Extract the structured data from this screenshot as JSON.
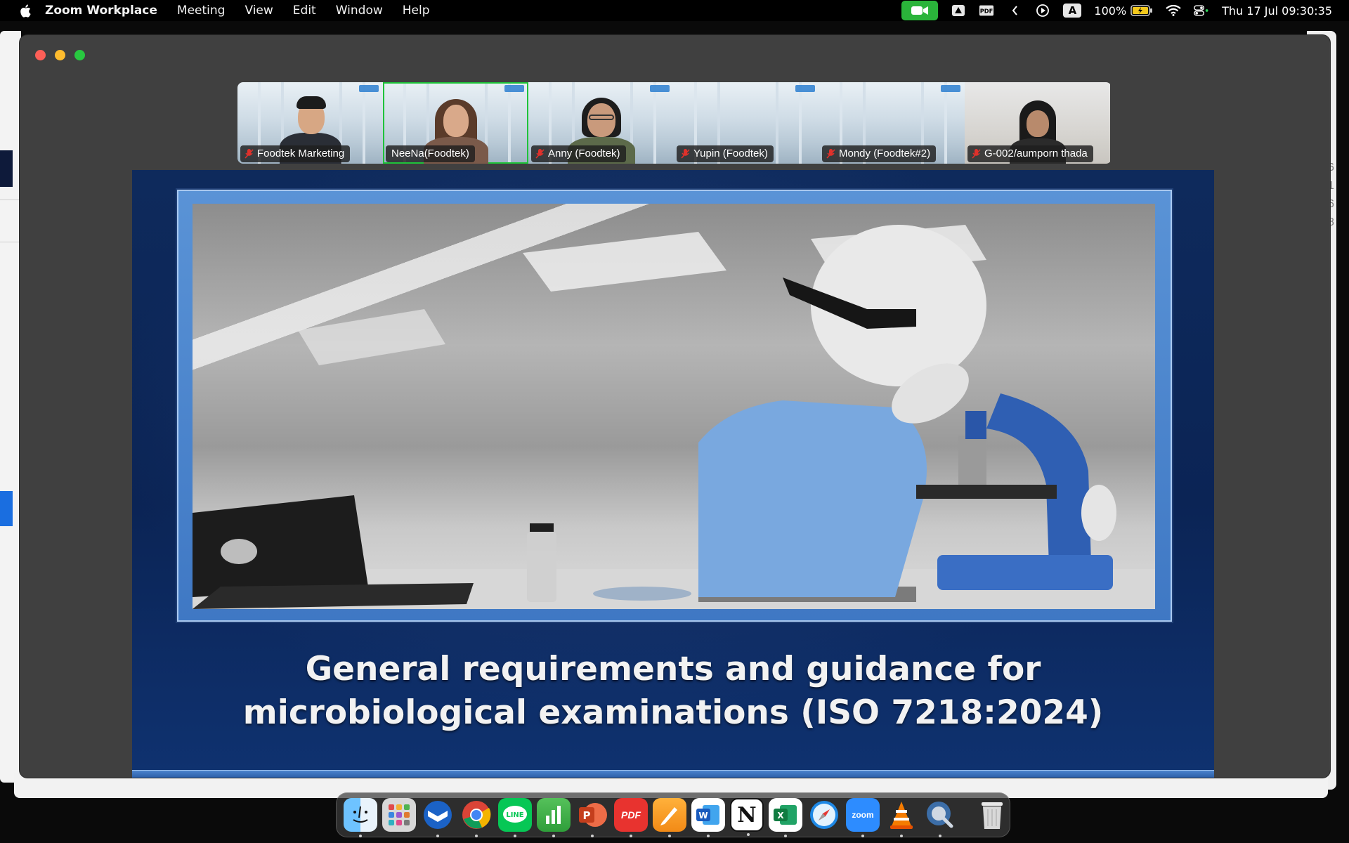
{
  "menubar": {
    "app_name": "Zoom Workplace",
    "menus": [
      "Meeting",
      "View",
      "Edit",
      "Window",
      "Help"
    ],
    "pdf_label": "PDF",
    "input_source": "A",
    "battery_percent": "100%",
    "clock": "Thu 17 Jul  09:30:35"
  },
  "participants": [
    {
      "name": "Foodtek Marketing",
      "muted": true,
      "active": false
    },
    {
      "name": "NeeNa(Foodtek)",
      "muted": false,
      "active": true
    },
    {
      "name": "Anny (Foodtek)",
      "muted": true,
      "active": false
    },
    {
      "name": "Yupin (Foodtek)",
      "muted": true,
      "active": false
    },
    {
      "name": "Mondy (Foodtek#2)",
      "muted": true,
      "active": false
    },
    {
      "name": "G-002/aumporn thada",
      "muted": true,
      "active": false
    }
  ],
  "slide": {
    "title_line1": "General requirements and guidance for",
    "title_line2": "microbiological examinations (ISO 7218:2024)"
  },
  "background_window_right": [
    "6",
    "1",
    "6",
    "8"
  ],
  "dock": {
    "apps": [
      "finder-icon",
      "launchpad-icon",
      "thunderbird-icon",
      "chrome-icon",
      "line-icon",
      "numbers-icon",
      "powerpoint-icon",
      "pdf-expert-icon",
      "pages-icon",
      "word-icon",
      "notion-icon",
      "excel-icon",
      "safari-icon",
      "zoom-icon",
      "vlc-icon",
      "quicktime-icon",
      "trash-icon"
    ],
    "zoom_label": "zoom",
    "pdf_label": "PDF",
    "notion_label": "N",
    "word_label": "W",
    "excel_label": "X",
    "powerpoint_label": "P"
  },
  "colors": {
    "active_speaker": "#1fc33a",
    "zoom_green": "#2ab43a",
    "slide_blue": "#0e2a5c"
  }
}
